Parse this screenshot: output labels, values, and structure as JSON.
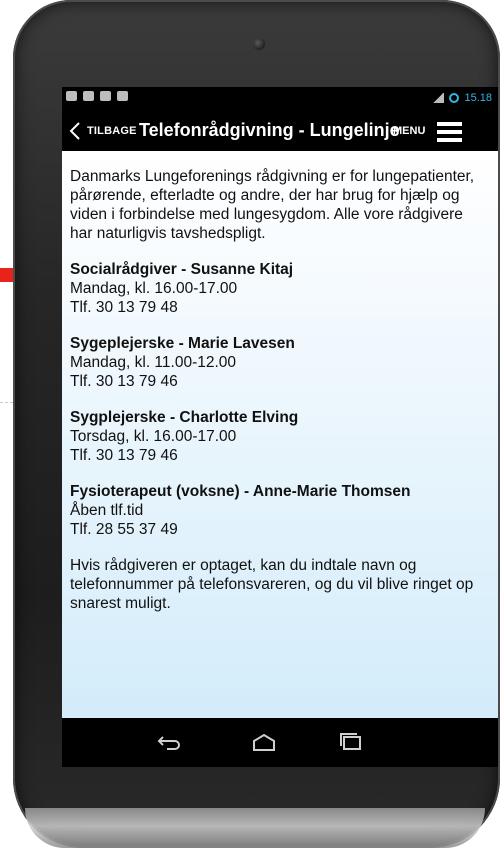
{
  "status_bar": {
    "time": "15.18"
  },
  "action_bar": {
    "back_label": "TILBAGE",
    "title": "Telefonrådgivning - Lungelinje",
    "menu_label": "MENU"
  },
  "content": {
    "intro": "Danmarks Lungeforenings rådgivning er for lungepatienter, pårørende, efterladte og andre, der har brug for hjælp og viden i forbindelse med lungesygdom. Alle vore rådgivere har naturligvis tavshedspligt.",
    "contacts": [
      {
        "name": "Socialrådgiver - Susanne Kitaj",
        "hours": "Mandag, kl. 16.00-17.00",
        "phone": "Tlf. 30 13 79 48"
      },
      {
        "name": "Sygeplejerske - Marie Lavesen",
        "hours": "Mandag, kl. 11.00-12.00",
        "phone": "Tlf. 30 13 79 46"
      },
      {
        "name": "Sygplejerske - Charlotte Elving",
        "hours": "Torsdag, kl. 16.00-17.00",
        "phone": "Tlf. 30 13 79 46"
      },
      {
        "name": "Fysioterapeut (voksne) - Anne-Marie Thomsen",
        "hours": "Åben tlf.tid",
        "phone": "Tlf. 28 55 37 49"
      }
    ],
    "outro": "Hvis rådgiveren er optaget, kan du indtale navn og telefonnummer på telefonsvareren, og du vil blive ringet op snarest muligt."
  },
  "nav_bar": {
    "icons": [
      "back-nav-icon",
      "home-nav-icon",
      "recents-nav-icon"
    ]
  },
  "colors": {
    "status_accent": "#33b5e5",
    "content_gradient_bottom": "#d3ecfa",
    "arrow": "#e8231c"
  }
}
